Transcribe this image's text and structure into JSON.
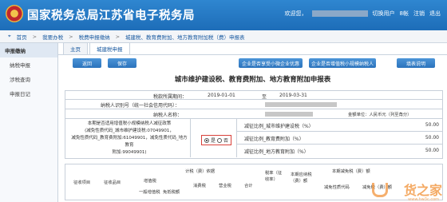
{
  "header": {
    "title": "国家税务总局江苏省电子税务局",
    "user_prefix": "欢迎您，",
    "user_links": [
      "切换用户",
      "8帐",
      "注销",
      "退出"
    ]
  },
  "breadcrumb": [
    "首页",
    "我要办税",
    "税费申报缴纳",
    "城建税、教育费附加、地方教育附加税（费）申报表"
  ],
  "sidebar": {
    "header": "申报缴纳",
    "items": [
      "纳税申报",
      "涉税查询",
      "申报日记"
    ]
  },
  "tabs": [
    "主页",
    "城建税申报"
  ],
  "toolbar": {
    "back": "返回",
    "save": "保存",
    "btn1": "企业是否享受小微企业优惠",
    "btn2": "企业是否增值税小规模纳税人",
    "btn3": "填表说明"
  },
  "form": {
    "title": "城市维护建设税、教育费附加、地方教育附加申报表",
    "period_label": "税款所属期间：",
    "period_from": "2019-01-01",
    "period_to_label": "至",
    "period_to": "2019-03-31",
    "taxpayer_id_label": "纳税人识别号（统一社会信用代码）：",
    "taxpayer_name_label": "纳税人名称：",
    "amount_unit": "金额单位：人民币元（列至角分）",
    "question": "本期是否适用增值税小规模纳税人减征政策（减免性质代码_城市维护建设税:07049901，减免性质代码_教育费附加:61049901，减免性质代码_地方教育附加:99049901）",
    "q_line1": "本期是否适用增值税小规模纳税人减征政策",
    "q_line2": "(减免性质代码_城市维护建设税:07049901，",
    "q_line3": "减免性质代码_教育费附加:61049901，减免性质代码_地方教育",
    "q_line4": "附加:99049901)",
    "yes": "是",
    "no": "否",
    "rates": [
      {
        "label": "减征比例_城市维护建设税（%）",
        "value": "50.00"
      },
      {
        "label": "减征比例_教育费附加（%）",
        "value": "50.00"
      },
      {
        "label": "减征比例_地方教育附加（%）",
        "value": "50.00"
      }
    ],
    "table_headers": {
      "h1": "计税（费）依据",
      "h2": "增值税",
      "h3": "一般增值税",
      "h4": "免抵税额",
      "h5": "消费税",
      "h6": "营业税",
      "h7": "合计",
      "h8": "税率（征收率）",
      "h9": "本期应纳税（费）额",
      "h10": "本期减免税（费）额",
      "h11": "减免性质代码",
      "h12": "减免税（费）额",
      "h13": "征收项目",
      "h14": "征收品目"
    }
  },
  "watermark": {
    "text": "货之家",
    "sub": "www.hw3c.com"
  }
}
